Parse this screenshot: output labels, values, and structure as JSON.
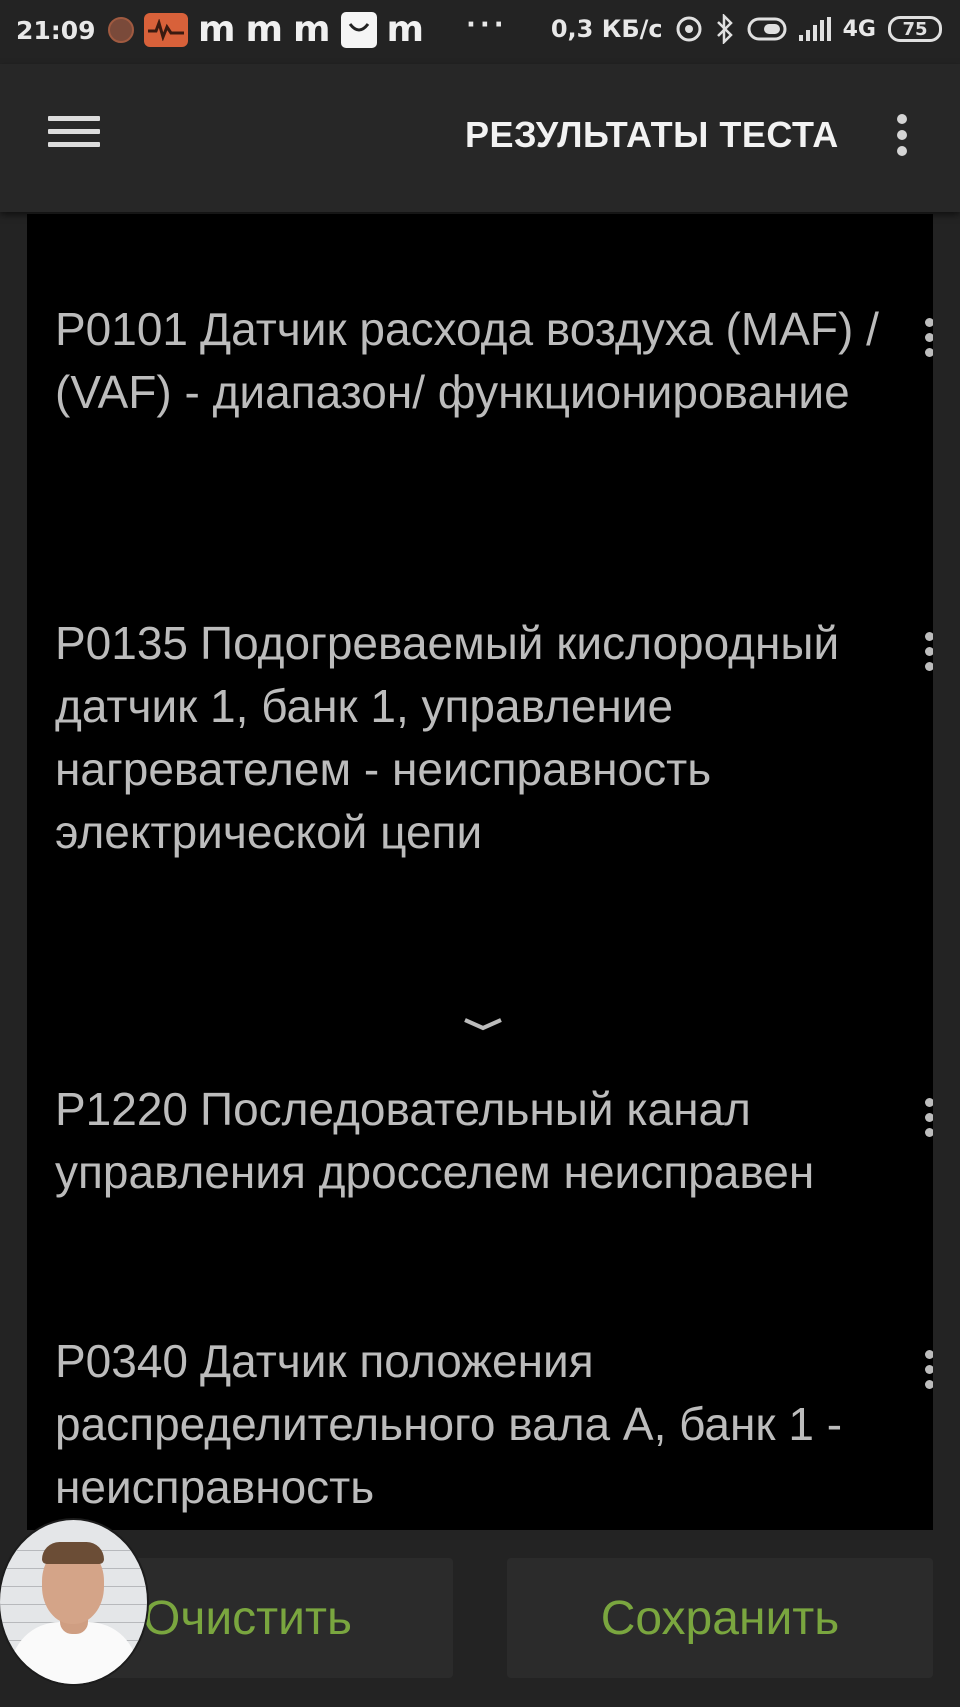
{
  "status_bar": {
    "time": "21:09",
    "app_letters": [
      "m",
      "m",
      "m",
      "m"
    ],
    "more_dots": "···",
    "net_speed": "0,3 КБ/с",
    "network_type": "4G",
    "battery_level": "75",
    "icons": [
      "obd-app-icon",
      "heart-monitor-icon",
      "shopping-bag-icon",
      "hotspot-icon",
      "bluetooth-icon",
      "toggle-icon",
      "signal-icon",
      "battery-icon"
    ]
  },
  "appbar": {
    "title": "РЕЗУЛЬТАТЫ ТЕСТА",
    "menu_icon": "hamburger-menu-icon",
    "overflow_icon": "more-vert-icon"
  },
  "results": [
    {
      "code": "P0101",
      "description": "Датчик расхода воздуха (MAF) / (VAF) - диапазон/ функционирование"
    },
    {
      "code": "P0135",
      "description": "Подогреваемый кислородный датчик 1, банк 1, управление нагревателем - неисправность электрической цепи"
    },
    {
      "code": "P1220",
      "description": "Последовательный канал управления дросселем неисправен"
    },
    {
      "code": "P0340",
      "description": "Датчик положения распределительного вала A, банк 1 - неисправность"
    }
  ],
  "buttons": {
    "clear_label": "Очистить",
    "save_label": "Сохранить"
  },
  "colors": {
    "background": "#232323",
    "panel": "#000000",
    "text": "#bcbcbc",
    "button_text": "#7aa63f",
    "button_bg": "#2b2b2b"
  }
}
